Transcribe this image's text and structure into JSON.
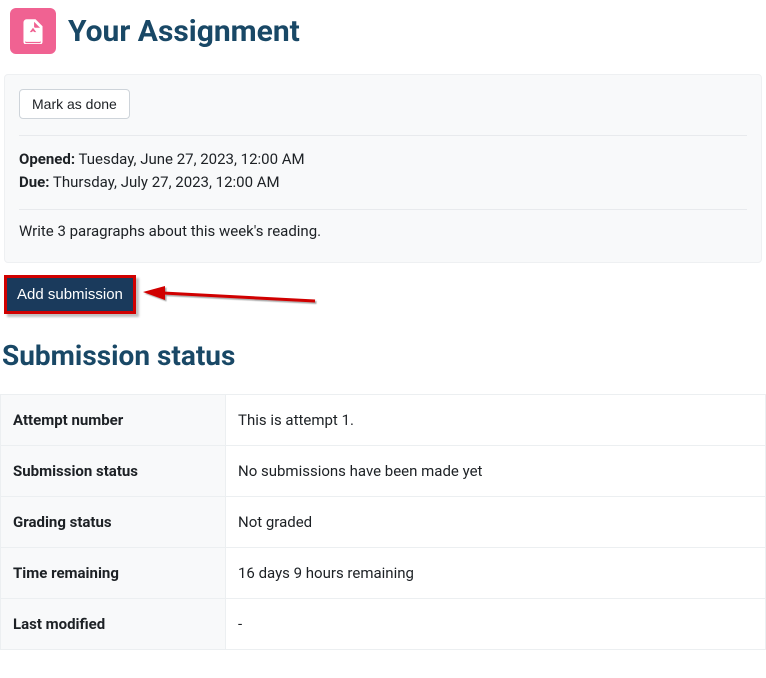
{
  "header": {
    "title": "Your Assignment"
  },
  "actions": {
    "mark_done_label": "Mark as done",
    "add_submission_label": "Add submission"
  },
  "dates": {
    "opened_label": "Opened:",
    "opened_value": "Tuesday, June 27, 2023, 12:00 AM",
    "due_label": "Due:",
    "due_value": "Thursday, July 27, 2023, 12:00 AM"
  },
  "description": "Write 3 paragraphs about this week's reading.",
  "status": {
    "heading": "Submission status",
    "rows": [
      {
        "label": "Attempt number",
        "value": "This is attempt 1."
      },
      {
        "label": "Submission status",
        "value": "No submissions have been made yet"
      },
      {
        "label": "Grading status",
        "value": "Not graded"
      },
      {
        "label": "Time remaining",
        "value": "16 days 9 hours remaining"
      },
      {
        "label": "Last modified",
        "value": "-"
      }
    ]
  }
}
